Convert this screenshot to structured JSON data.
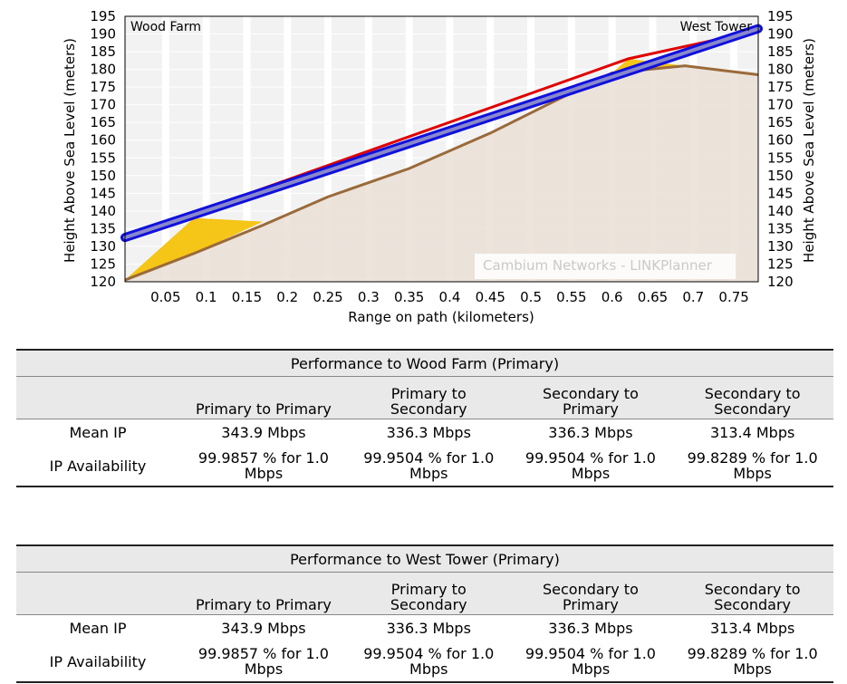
{
  "chart_data": {
    "type": "line",
    "xlabel": "Range on path (kilometers)",
    "ylabel": "Height Above Sea Level (meters)",
    "ylabel_right": "Height Above Sea Level (meters)",
    "xlim": [
      0,
      0.78
    ],
    "ylim": [
      120,
      195
    ],
    "x_ticks": [
      "0.05",
      "0.1",
      "0.15",
      "0.2",
      "0.25",
      "0.3",
      "0.35",
      "0.4",
      "0.45",
      "0.5",
      "0.55",
      "0.6",
      "0.65",
      "0.7",
      "0.75"
    ],
    "y_ticks": [
      "120",
      "125",
      "130",
      "135",
      "140",
      "145",
      "150",
      "155",
      "160",
      "165",
      "170",
      "175",
      "180",
      "185",
      "190",
      "195"
    ],
    "grid": true,
    "left_site": "Wood Farm",
    "right_site": "West Tower",
    "watermark": "Cambium Networks - LINKPlanner",
    "terrain": {
      "x": [
        0,
        0.085,
        0.17,
        0.25,
        0.35,
        0.45,
        0.52,
        0.6,
        0.69,
        0.78
      ],
      "y": [
        120.5,
        128,
        136,
        144,
        152,
        162,
        170,
        179,
        181,
        178.5
      ]
    },
    "obstructions": [
      {
        "x": [
          0,
          0.085,
          0.17,
          0.085
        ],
        "y": [
          120.5,
          138,
          137,
          128
        ]
      },
      {
        "x": [
          0.6,
          0.62,
          0.69,
          0.63
        ],
        "y": [
          179,
          183,
          181,
          180
        ]
      }
    ],
    "series": [
      {
        "color": "#e00000",
        "x": [
          0,
          0.62,
          0.78
        ],
        "y": [
          132.5,
          183,
          191
        ]
      },
      {
        "color": "#1010dd",
        "x": [
          0,
          0.78
        ],
        "y": [
          132.5,
          191.5
        ]
      },
      {
        "color": "#8888cc",
        "x": [
          0,
          0.78
        ],
        "y": [
          132.5,
          191.5
        ]
      }
    ]
  },
  "tables": [
    {
      "title": "Performance to Wood Farm (Primary)",
      "headers": [
        "Primary to Primary",
        "Primary to Secondary",
        "Secondary to Primary",
        "Secondary to Secondary"
      ],
      "rows": [
        {
          "label": "Mean IP",
          "values": [
            "343.9 Mbps",
            "336.3 Mbps",
            "336.3 Mbps",
            "313.4 Mbps"
          ]
        },
        {
          "label": "IP Availability",
          "values": [
            "99.9857 % for 1.0 Mbps",
            "99.9504 % for 1.0 Mbps",
            "99.9504 % for 1.0 Mbps",
            "99.8289 % for 1.0 Mbps"
          ]
        }
      ]
    },
    {
      "title": "Performance to West Tower (Primary)",
      "headers": [
        "Primary to Primary",
        "Primary to Secondary",
        "Secondary to Primary",
        "Secondary to Secondary"
      ],
      "rows": [
        {
          "label": "Mean IP",
          "values": [
            "343.9 Mbps",
            "336.3 Mbps",
            "336.3 Mbps",
            "313.4 Mbps"
          ]
        },
        {
          "label": "IP Availability",
          "values": [
            "99.9857 % for 1.0 Mbps",
            "99.9504 % for 1.0 Mbps",
            "99.9504 % for 1.0 Mbps",
            "99.8289 % for 1.0 Mbps"
          ]
        }
      ]
    }
  ],
  "colors": {
    "terrain_fill": "#eadfd6",
    "terrain_line": "#9a6a3a",
    "obstruction": "#f5c518",
    "plot_bg": "#f2f2f2",
    "header_bg": "#e9e9e9"
  }
}
